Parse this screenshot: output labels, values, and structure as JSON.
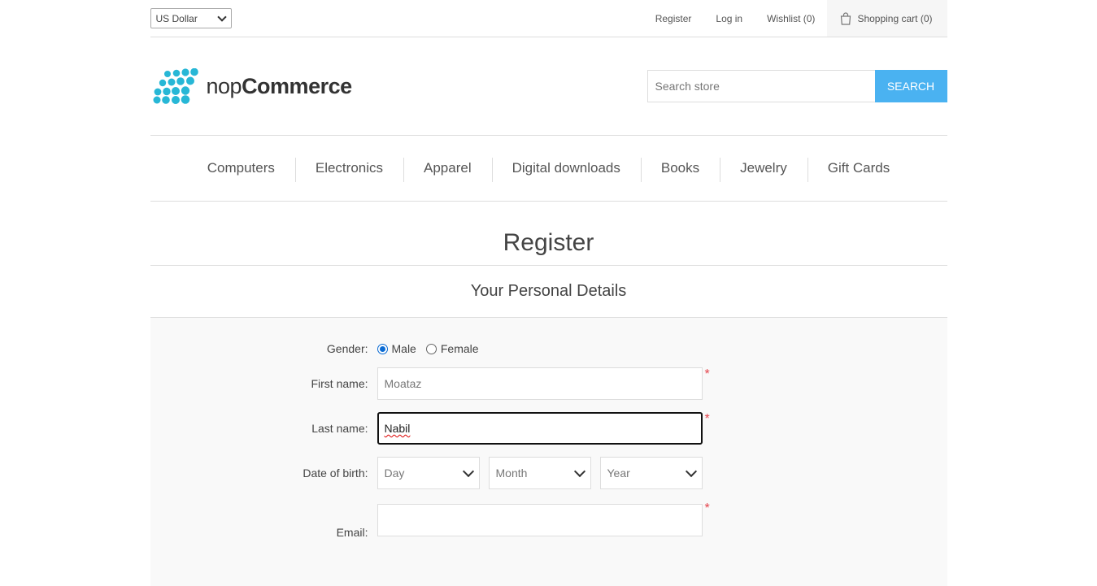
{
  "header": {
    "currency": "US Dollar",
    "links": {
      "register": "Register",
      "login": "Log in",
      "wishlist": "Wishlist (0)",
      "cart": "Shopping cart (0)"
    },
    "logo": {
      "light": "nop",
      "bold": "Commerce"
    },
    "search": {
      "placeholder": "Search store",
      "button": "SEARCH"
    }
  },
  "menu": [
    "Computers",
    "Electronics",
    "Apparel",
    "Digital downloads",
    "Books",
    "Jewelry",
    "Gift Cards"
  ],
  "page": {
    "title": "Register",
    "section": "Your Personal Details"
  },
  "form": {
    "gender": {
      "label": "Gender:",
      "male": "Male",
      "female": "Female",
      "selected": "Male"
    },
    "first_name": {
      "label": "First name:",
      "value": "Moataz"
    },
    "last_name": {
      "label": "Last name:",
      "value": "Nabil"
    },
    "dob": {
      "label": "Date of birth:",
      "day": "Day",
      "month": "Month",
      "year": "Year"
    },
    "email": {
      "label": "Email:",
      "value": ""
    },
    "required_mark": "*"
  },
  "colors": {
    "accent": "#4ab2f1",
    "required": "#e4434b",
    "panel": "#f9f9f9"
  }
}
